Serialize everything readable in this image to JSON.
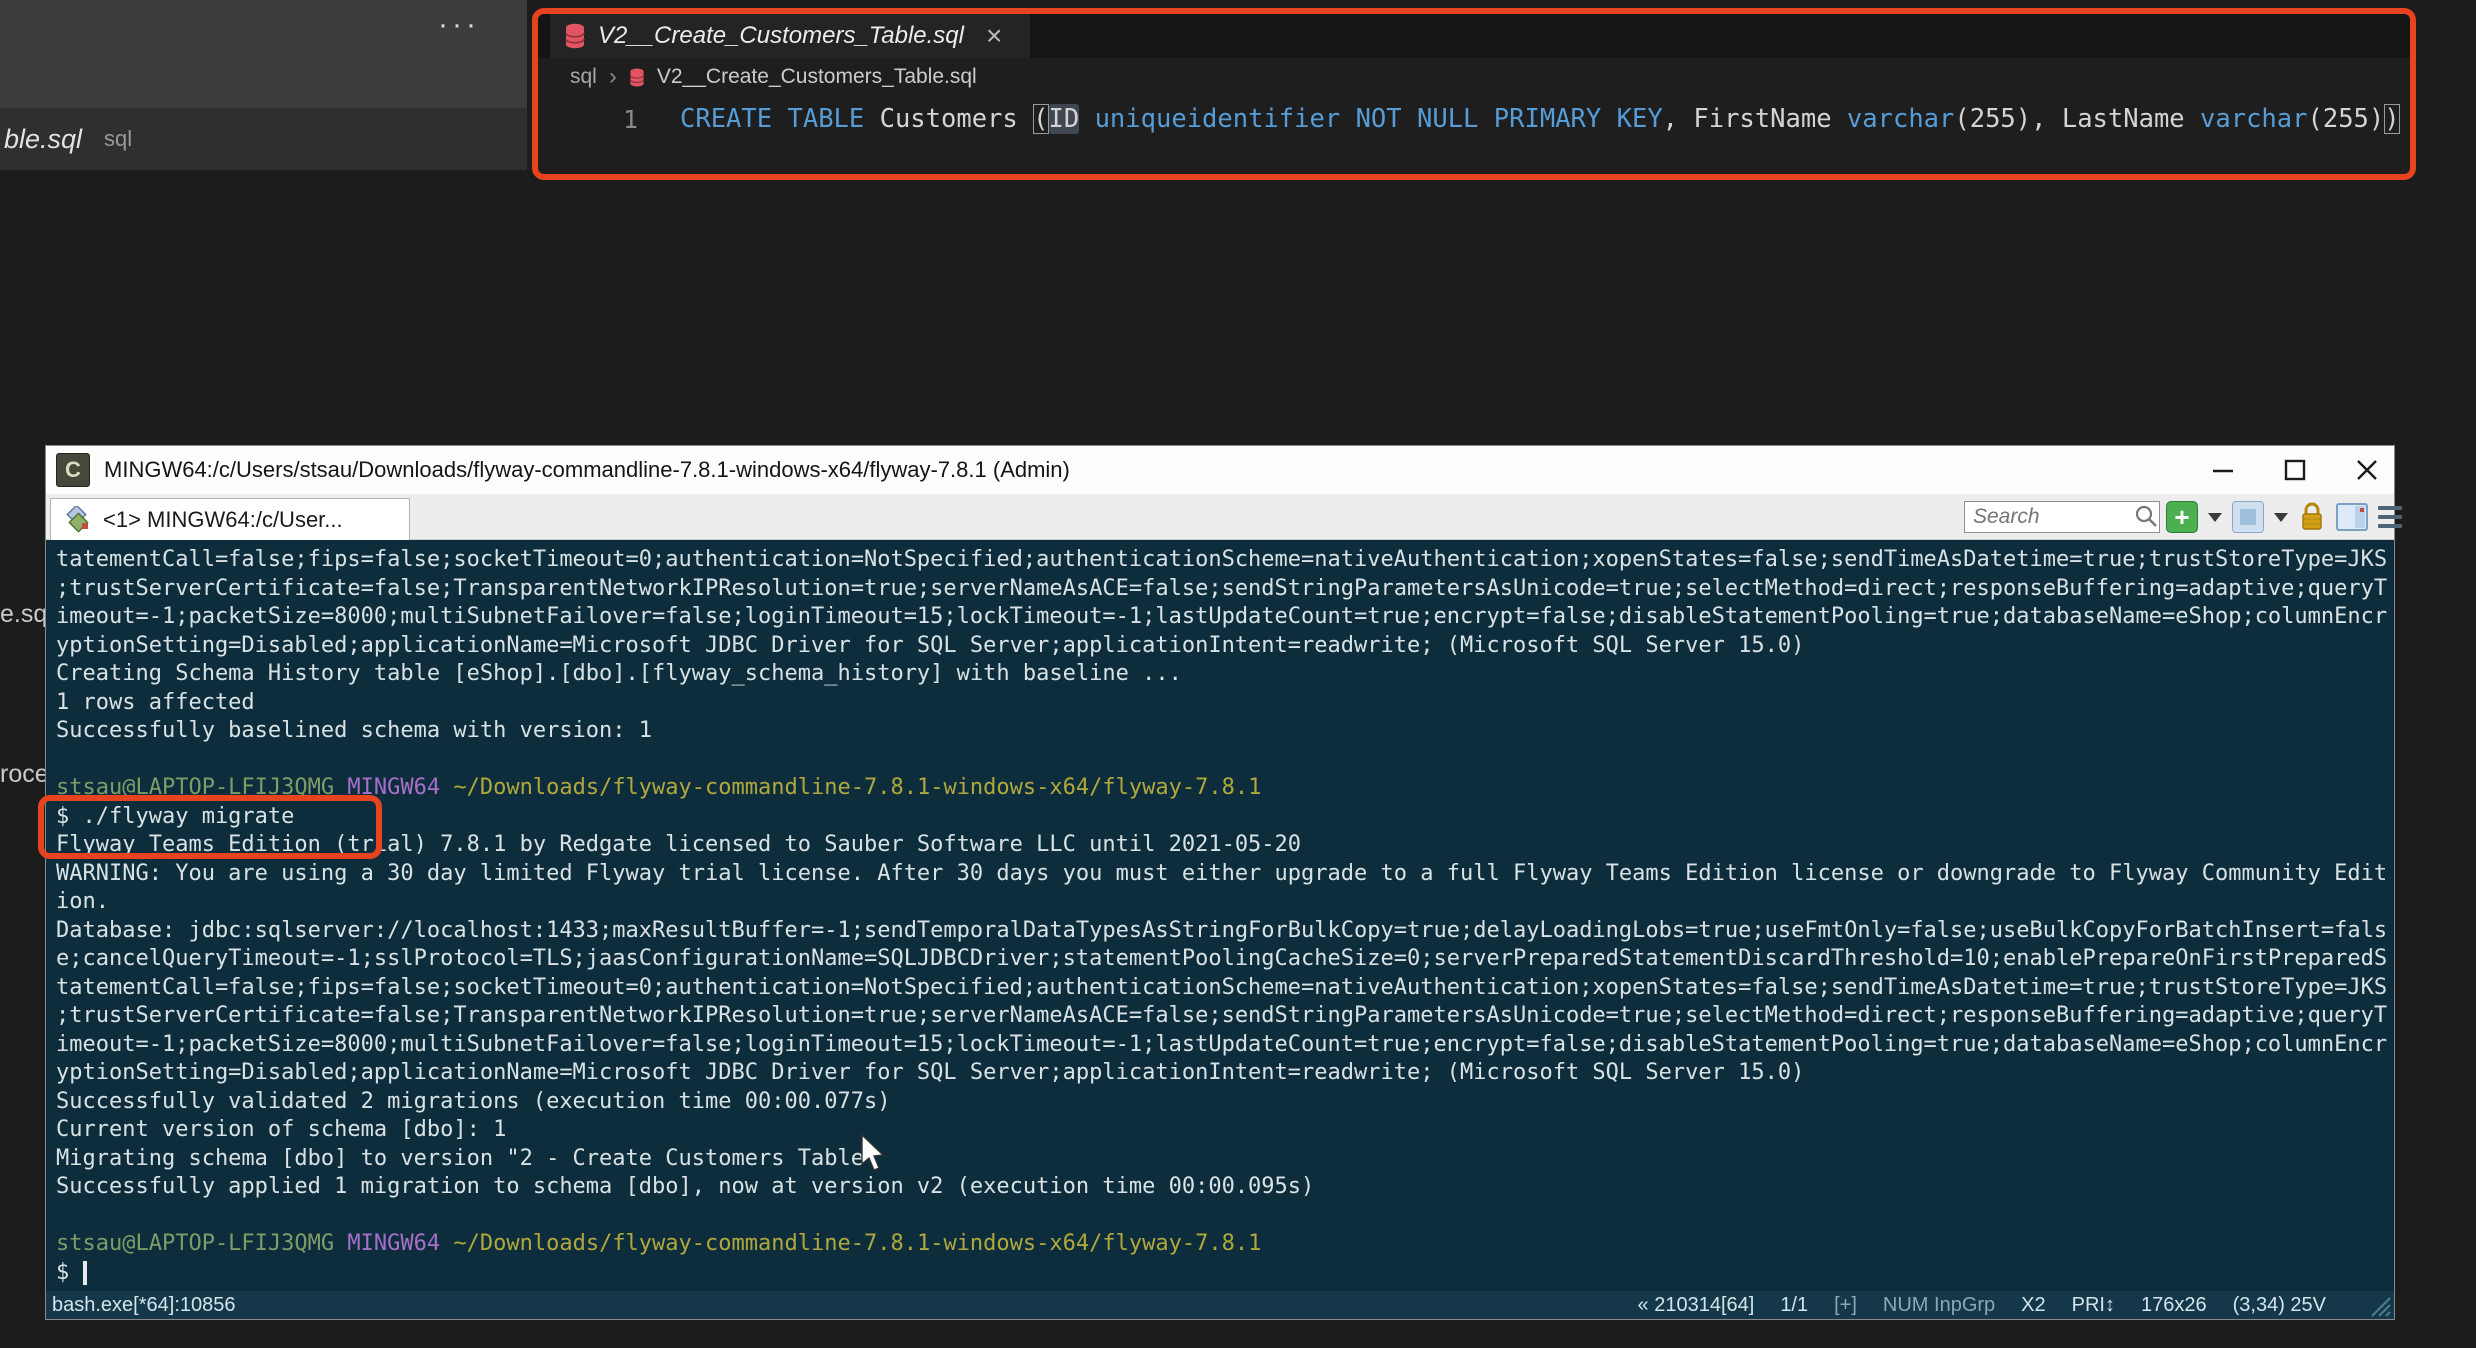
{
  "backdrop": {
    "ellipsis": "···",
    "partial_tab_label": "ble.sql",
    "partial_tab_suffix": "sql",
    "fragment_1": "e.sq",
    "fragment_2": "roce"
  },
  "annotation_color": "#e8431f",
  "editor": {
    "tab": {
      "title": "V2__Create_Customers_Table.sql",
      "close_glyph": "×"
    },
    "breadcrumb": {
      "folder": "sql",
      "separator": "›",
      "file": "V2__Create_Customers_Table.sql"
    },
    "code": {
      "line_number": "1",
      "segments": [
        {
          "t": "CREATE",
          "c": "kw"
        },
        {
          "t": " ",
          "c": ""
        },
        {
          "t": "TABLE",
          "c": "kw"
        },
        {
          "t": " Customers ",
          "c": ""
        },
        {
          "t": "(",
          "c": "brk"
        },
        {
          "t": "ID",
          "c": "hl"
        },
        {
          "t": " ",
          "c": ""
        },
        {
          "t": "uniqueidentifier",
          "c": "kw"
        },
        {
          "t": " ",
          "c": ""
        },
        {
          "t": "NOT",
          "c": "kw"
        },
        {
          "t": " ",
          "c": ""
        },
        {
          "t": "NULL",
          "c": "kw"
        },
        {
          "t": " ",
          "c": ""
        },
        {
          "t": "PRIMARY",
          "c": "kw"
        },
        {
          "t": " ",
          "c": ""
        },
        {
          "t": "KEY",
          "c": "kw"
        },
        {
          "t": ", FirstName ",
          "c": ""
        },
        {
          "t": "varchar",
          "c": "kw"
        },
        {
          "t": "(255), LastName ",
          "c": ""
        },
        {
          "t": "varchar",
          "c": "kw"
        },
        {
          "t": "(255)",
          "c": ""
        },
        {
          "t": ")",
          "c": "brk"
        }
      ]
    }
  },
  "terminal": {
    "title": "MINGW64:/c/Users/stsau/Downloads/flyway-commandline-7.8.1-windows-x64/flyway-7.8.1 (Admin)",
    "app_icon_glyph": "C",
    "tab_label": "<1> MINGW64:/c/User...",
    "search_placeholder": "Search",
    "colors": {
      "background": "#0e2d3c",
      "foreground": "#d8e2e4",
      "user": "#7d9c68",
      "host_env": "#a86fc9",
      "path": "#b1a83c"
    },
    "lines": [
      "tatementCall=false;fips=false;socketTimeout=0;authentication=NotSpecified;authenticationScheme=nativeAuthentication;xopenStates=false;sendTimeAsDatetime=true;trustStoreType=JKS",
      ";trustServerCertificate=false;TransparentNetworkIPResolution=true;serverNameAsACE=false;sendStringParametersAsUnicode=true;selectMethod=direct;responseBuffering=adaptive;queryT",
      "imeout=-1;packetSize=8000;multiSubnetFailover=false;loginTimeout=15;lockTimeout=-1;lastUpdateCount=true;encrypt=false;disableStatementPooling=true;databaseName=eShop;columnEncr",
      "yptionSetting=Disabled;applicationName=Microsoft JDBC Driver for SQL Server;applicationIntent=readwrite; (Microsoft SQL Server 15.0)",
      "Creating Schema History table [eShop].[dbo].[flyway_schema_history] with baseline ...",
      "1 rows affected",
      "Successfully baselined schema with version: 1",
      "",
      [
        {
          "t": "stsau@LAPTOP-LFIJ3QMG",
          "c": "green"
        },
        {
          "t": " ",
          "c": ""
        },
        {
          "t": "MINGW64",
          "c": "purple"
        },
        {
          "t": " ",
          "c": ""
        },
        {
          "t": "~/Downloads/flyway-commandline-7.8.1-windows-x64/flyway-7.8.1",
          "c": "yellow"
        }
      ],
      "$ ./flyway migrate",
      "Flyway Teams Edition (trial) 7.8.1 by Redgate licensed to Sauber Software LLC until 2021-05-20",
      "WARNING: You are using a 30 day limited Flyway trial license. After 30 days you must either upgrade to a full Flyway Teams Edition license or downgrade to Flyway Community Edit",
      "ion.",
      "Database: jdbc:sqlserver://localhost:1433;maxResultBuffer=-1;sendTemporalDataTypesAsStringForBulkCopy=true;delayLoadingLobs=true;useFmtOnly=false;useBulkCopyForBatchInsert=fals",
      "e;cancelQueryTimeout=-1;sslProtocol=TLS;jaasConfigurationName=SQLJDBCDriver;statementPoolingCacheSize=0;serverPreparedStatementDiscardThreshold=10;enablePrepareOnFirstPreparedS",
      "tatementCall=false;fips=false;socketTimeout=0;authentication=NotSpecified;authenticationScheme=nativeAuthentication;xopenStates=false;sendTimeAsDatetime=true;trustStoreType=JKS",
      ";trustServerCertificate=false;TransparentNetworkIPResolution=true;serverNameAsACE=false;sendStringParametersAsUnicode=true;selectMethod=direct;responseBuffering=adaptive;queryT",
      "imeout=-1;packetSize=8000;multiSubnetFailover=false;loginTimeout=15;lockTimeout=-1;lastUpdateCount=true;encrypt=false;disableStatementPooling=true;databaseName=eShop;columnEncr",
      "yptionSetting=Disabled;applicationName=Microsoft JDBC Driver for SQL Server;applicationIntent=readwrite; (Microsoft SQL Server 15.0)",
      "Successfully validated 2 migrations (execution time 00:00.077s)",
      "Current version of schema [dbo]: 1",
      "Migrating schema [dbo] to version \"2 - Create Customers Table\"",
      "Successfully applied 1 migration to schema [dbo], now at version v2 (execution time 00:00.095s)",
      "",
      [
        {
          "t": "stsau@LAPTOP-LFIJ3QMG",
          "c": "green"
        },
        {
          "t": " ",
          "c": ""
        },
        {
          "t": "MINGW64",
          "c": "purple"
        },
        {
          "t": " ",
          "c": ""
        },
        {
          "t": "~/Downloads/flyway-commandline-7.8.1-windows-x64/flyway-7.8.1",
          "c": "yellow"
        }
      ],
      [
        {
          "t": "$ ",
          "c": ""
        },
        {
          "t": "",
          "c": "cursor"
        }
      ]
    ],
    "status": {
      "left": "bash.exe[*64]:10856",
      "right": [
        "« 210314[64]",
        "1/1",
        "[+]",
        "NUM InpGrp",
        "X2",
        "PRI↕",
        "176x26",
        "(3,34) 25V"
      ]
    }
  }
}
